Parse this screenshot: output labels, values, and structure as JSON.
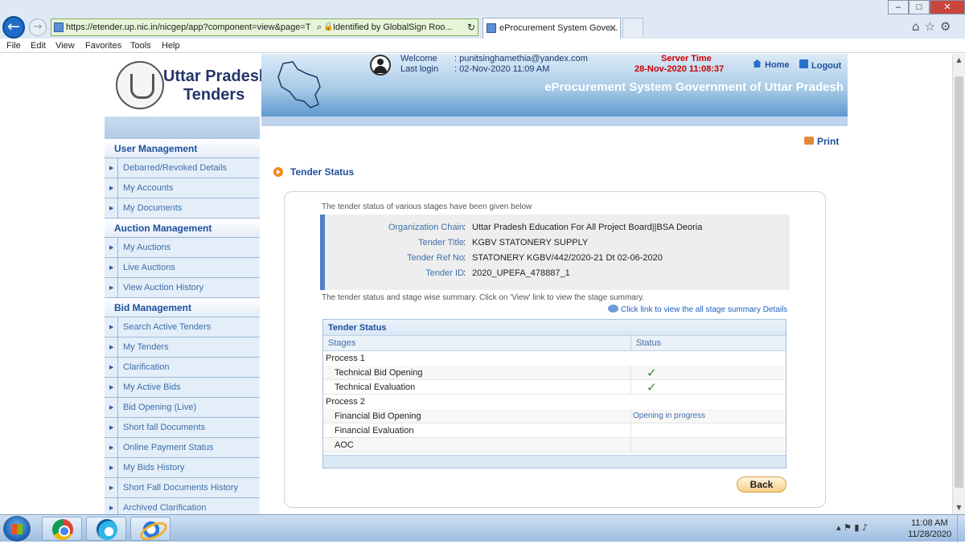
{
  "browser": {
    "url": "https://etender.up.nic.in/nicgep/app?component=view&page=T",
    "cert": "Identified by GlobalSign Roo...",
    "tab_title": "eProcurement System Gove...",
    "menu": [
      "File",
      "Edit",
      "View",
      "Favorites",
      "Tools",
      "Help"
    ]
  },
  "header": {
    "logo_line1": "Uttar Pradesh",
    "logo_line2": "Tenders",
    "welcome_label": "Welcome",
    "welcome_value": ": punitsinghamethia@yandex.com",
    "lastlogin_label": "Last login",
    "lastlogin_value": ": 02-Nov-2020 11:09 AM",
    "server_time_label": "Server Time",
    "server_time_value": "28-Nov-2020 11:08:37",
    "home": "Home",
    "logout": "Logout",
    "system_title": "eProcurement System Government of Uttar Pradesh"
  },
  "sidebar": {
    "user_management": "User Management",
    "user_items": [
      "Debarred/Revoked Details",
      "My Accounts",
      "My Documents"
    ],
    "auction_management": "Auction Management",
    "auction_items": [
      "My Auctions",
      "Live Auctions",
      "View Auction History"
    ],
    "bid_management": "Bid Management",
    "bid_items": [
      "Search Active Tenders",
      "My Tenders",
      "Clarification",
      "My Active Bids",
      "Bid Opening (Live)",
      "Short fall Documents",
      "Online Payment Status",
      "My Bids History",
      "Short Fall Documents History",
      "Archived Clarification"
    ]
  },
  "main": {
    "print": "Print",
    "heading": "Tender Status",
    "intro": "The tender status of various stages have been given below",
    "info": {
      "org_label": "Organization Chain",
      "org_value": "Uttar Pradesh Education For All Project Board||BSA Deoria",
      "title_label": "Tender Title",
      "title_value": "KGBV STATONERY SUPPLY",
      "ref_label": "Tender Ref No",
      "ref_value": "STATONERY KGBV/442/2020-21 Dt 02-06-2020",
      "id_label": "Tender ID",
      "id_value": "2020_UPEFA_478887_1",
      "colon": ":"
    },
    "summary": "The tender status and stage wise summary. Click on 'View' link to view the stage summary.",
    "stage_link": "Click link to view the all stage summary Details",
    "table": {
      "title": "Tender Status",
      "col_stages": "Stages",
      "col_status": "Status",
      "process1": "Process 1",
      "p1_rows": [
        {
          "stage": "Technical Bid Opening",
          "status": "✓"
        },
        {
          "stage": "Technical Evaluation",
          "status": "✓"
        }
      ],
      "process2": "Process 2",
      "p2_rows": [
        {
          "stage": "Financial Bid Opening",
          "status": "Opening in progress"
        },
        {
          "stage": "Financial Evaluation",
          "status": ""
        },
        {
          "stage": "AOC",
          "status": ""
        }
      ]
    },
    "back": "Back"
  },
  "taskbar": {
    "time": "11:08 AM",
    "date": "11/28/2020"
  }
}
